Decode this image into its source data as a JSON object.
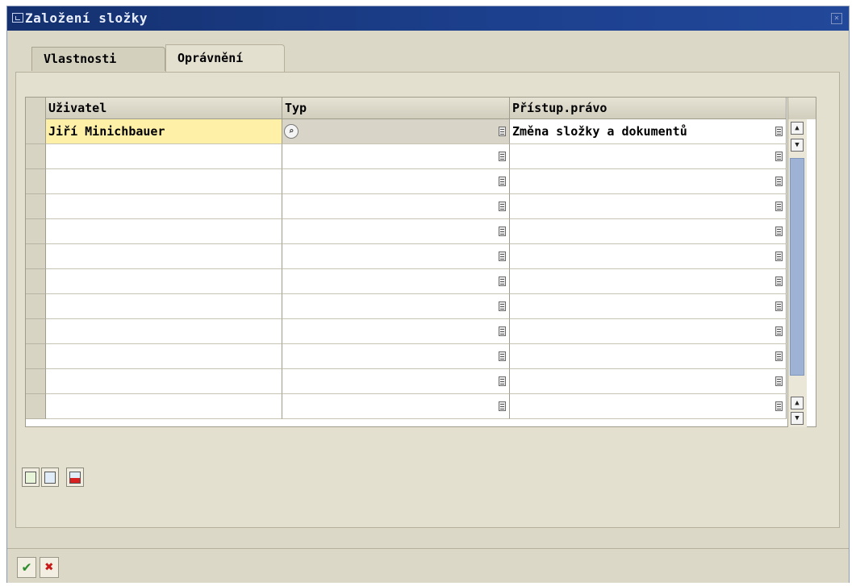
{
  "window": {
    "title": "Založení složky"
  },
  "tabs": [
    {
      "label": "Vlastnosti",
      "active": false
    },
    {
      "label": "Oprávnění",
      "active": true
    }
  ],
  "table": {
    "columns": [
      "Uživatel",
      "Typ",
      "Přístup.právo"
    ],
    "rows": [
      {
        "user": "Jiří Minichbauer",
        "typ": "",
        "pravo": "Změna složky a dokumentů"
      },
      {
        "user": "",
        "typ": "",
        "pravo": ""
      },
      {
        "user": "",
        "typ": "",
        "pravo": ""
      },
      {
        "user": "",
        "typ": "",
        "pravo": ""
      },
      {
        "user": "",
        "typ": "",
        "pravo": ""
      },
      {
        "user": "",
        "typ": "",
        "pravo": ""
      },
      {
        "user": "",
        "typ": "",
        "pravo": ""
      },
      {
        "user": "",
        "typ": "",
        "pravo": ""
      },
      {
        "user": "",
        "typ": "",
        "pravo": ""
      },
      {
        "user": "",
        "typ": "",
        "pravo": ""
      },
      {
        "user": "",
        "typ": "",
        "pravo": ""
      },
      {
        "user": "",
        "typ": "",
        "pravo": ""
      }
    ]
  },
  "icons": {
    "close": "close-icon",
    "f4_help": "value-help-icon",
    "combo": "object-type-icon",
    "scroll_up": "scroll-up-icon",
    "scroll_down": "scroll-down-icon",
    "confirm": "checkmark-icon",
    "cancel": "cancel-x-icon"
  },
  "colors": {
    "title_bar": "#1c3f8c",
    "active_cell": "#fff0a8",
    "scroll_thumb": "#9db2d4",
    "confirm": "#2e8b2e",
    "cancel": "#c81818"
  }
}
